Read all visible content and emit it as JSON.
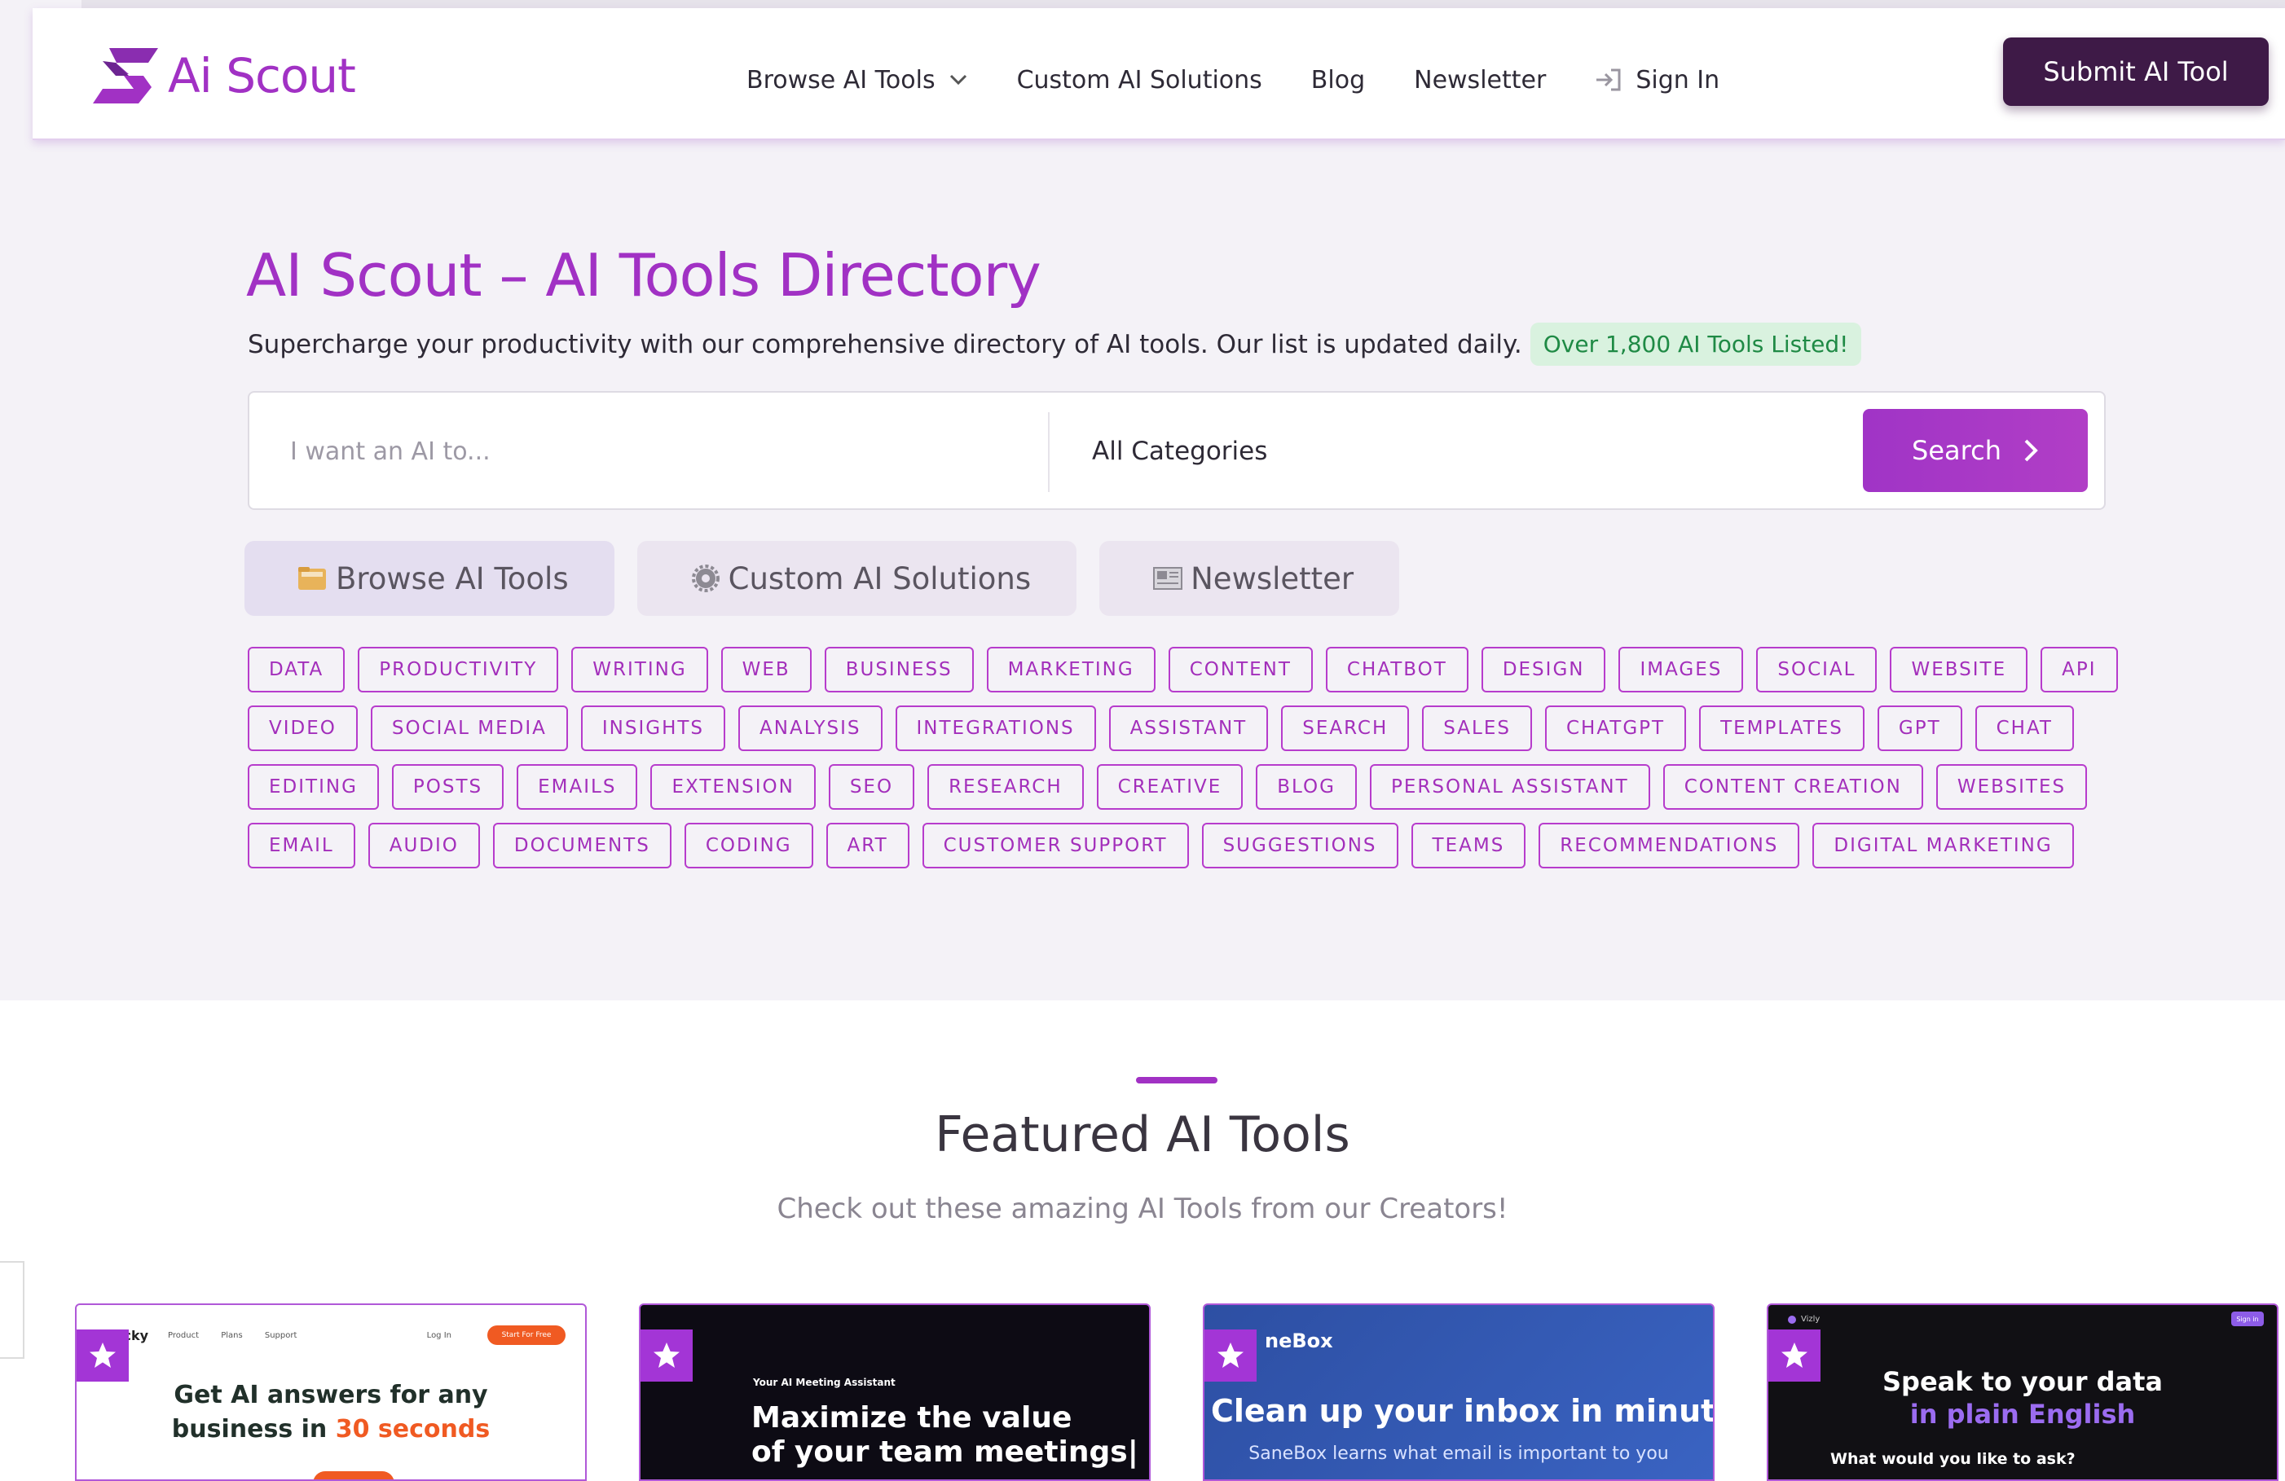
{
  "header": {
    "logo_text": "Ai Scout",
    "nav": {
      "browse": "Browse AI Tools",
      "custom": "Custom AI Solutions",
      "blog": "Blog",
      "newsletter": "Newsletter",
      "signin": "Sign In"
    },
    "submit_label": "Submit AI Tool"
  },
  "hero": {
    "title": "AI Scout – AI Tools Directory",
    "subtitle": "Supercharge your productivity with our comprehensive directory of AI tools. Our list is updated daily.",
    "badge": "Over 1,800 AI Tools Listed!"
  },
  "search": {
    "placeholder": "I want an AI to...",
    "value": "",
    "category": "All Categories",
    "button": "Search"
  },
  "quick_tabs": {
    "browse": "Browse AI Tools",
    "custom": "Custom AI Solutions",
    "newsletter": "Newsletter"
  },
  "tags": [
    [
      "DATA",
      "PRODUCTIVITY",
      "WRITING",
      "WEB",
      "BUSINESS",
      "MARKETING",
      "CONTENT",
      "CHATBOT",
      "DESIGN",
      "IMAGES",
      "SOCIAL",
      "WEBSITE",
      "API"
    ],
    [
      "VIDEO",
      "SOCIAL MEDIA",
      "INSIGHTS",
      "ANALYSIS",
      "INTEGRATIONS",
      "ASSISTANT",
      "SEARCH",
      "SALES",
      "CHATGPT",
      "TEMPLATES",
      "GPT",
      "CHAT"
    ],
    [
      "EDITING",
      "POSTS",
      "EMAILS",
      "EXTENSION",
      "SEO",
      "RESEARCH",
      "CREATIVE",
      "BLOG",
      "PERSONAL ASSISTANT",
      "CONTENT CREATION",
      "WEBSITES"
    ],
    [
      "EMAIL",
      "AUDIO",
      "DOCUMENTS",
      "CODING",
      "ART",
      "CUSTOMER SUPPORT",
      "SUGGESTIONS",
      "TEAMS",
      "RECOMMENDATIONS",
      "DIGITAL MARKETING"
    ]
  ],
  "featured": {
    "title": "Featured AI Tools",
    "subtitle": "Check out these amazing AI Tools from our Creators!",
    "cards": [
      {
        "brand": "macky",
        "nav": [
          "Product",
          "Plans",
          "Support"
        ],
        "login": "Log In",
        "cta": "Start For Free",
        "headline_1": "Get AI answers for any",
        "headline_2": "business in ",
        "headline_accent": "30 seconds"
      },
      {
        "kicker": "Your AI Meeting Assistant",
        "headline_1": "Maximize the value",
        "headline_2": "of your team meetings|"
      },
      {
        "brand": "neBox",
        "headline": "Clean up your inbox in minutes!",
        "sub": "SaneBox learns what email is important to you"
      },
      {
        "brand": "Vizly",
        "signin": "Sign in",
        "headline_1": "Speak to your data",
        "headline_accent": "in plain English",
        "question": "What would you like to ask?"
      }
    ]
  },
  "colors": {
    "brand_purple": "#a131c4",
    "submit_bg": "#3e1a47",
    "badge_bg": "#d9f2df",
    "badge_text": "#1f8a45"
  }
}
